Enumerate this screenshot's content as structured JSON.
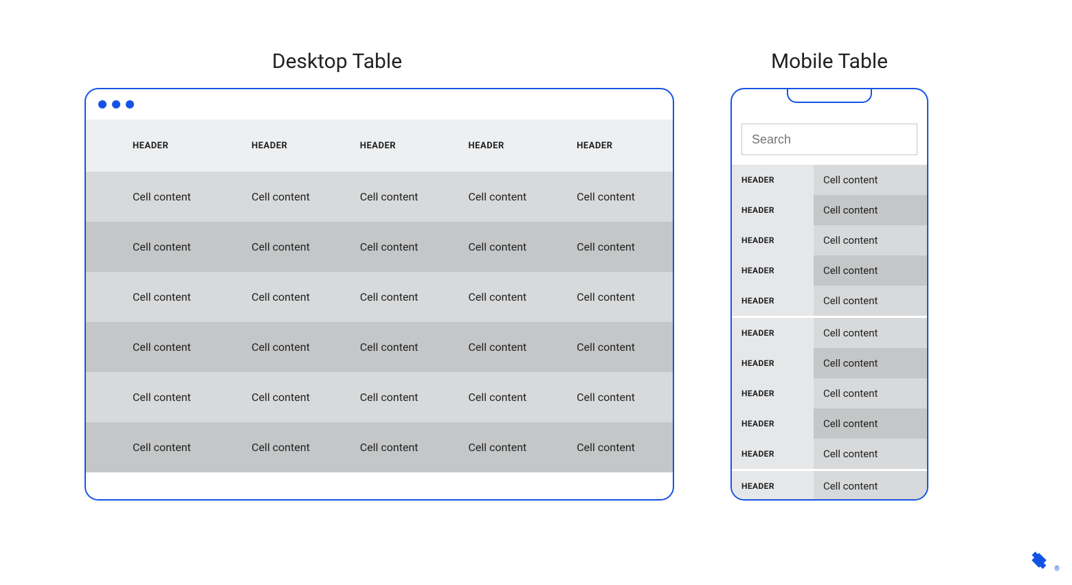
{
  "titles": {
    "desktop": "Desktop Table",
    "mobile": "Mobile Table"
  },
  "search": {
    "placeholder": "Search"
  },
  "desktop": {
    "headers": [
      "HEADER",
      "HEADER",
      "HEADER",
      "HEADER",
      "HEADER"
    ],
    "rows": [
      [
        "Cell content",
        "Cell content",
        "Cell content",
        "Cell content",
        "Cell content"
      ],
      [
        "Cell content",
        "Cell content",
        "Cell content",
        "Cell content",
        "Cell content"
      ],
      [
        "Cell content",
        "Cell content",
        "Cell content",
        "Cell content",
        "Cell content"
      ],
      [
        "Cell content",
        "Cell content",
        "Cell content",
        "Cell content",
        "Cell content"
      ],
      [
        "Cell content",
        "Cell content",
        "Cell content",
        "Cell content",
        "Cell content"
      ],
      [
        "Cell content",
        "Cell content",
        "Cell content",
        "Cell content",
        "Cell content"
      ]
    ]
  },
  "mobile": {
    "groups": [
      [
        {
          "header": "HEADER",
          "cell": "Cell content"
        },
        {
          "header": "HEADER",
          "cell": "Cell content"
        },
        {
          "header": "HEADER",
          "cell": "Cell content"
        },
        {
          "header": "HEADER",
          "cell": "Cell content"
        },
        {
          "header": "HEADER",
          "cell": "Cell content"
        }
      ],
      [
        {
          "header": "HEADER",
          "cell": "Cell content"
        },
        {
          "header": "HEADER",
          "cell": "Cell content"
        },
        {
          "header": "HEADER",
          "cell": "Cell content"
        },
        {
          "header": "HEADER",
          "cell": "Cell content"
        },
        {
          "header": "HEADER",
          "cell": "Cell content"
        }
      ],
      [
        {
          "header": "HEADER",
          "cell": "Cell content"
        }
      ]
    ]
  },
  "trademark": "®"
}
